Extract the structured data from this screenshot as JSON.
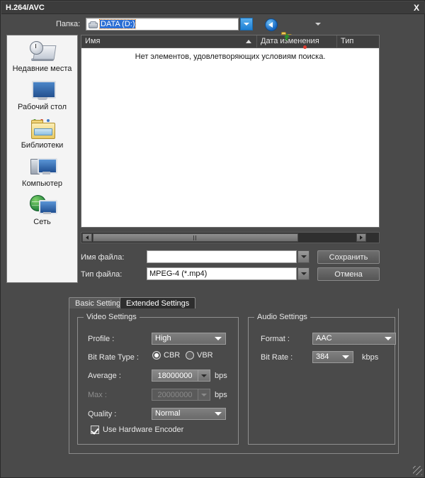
{
  "window": {
    "title": "H.264/AVC",
    "close_label": "X"
  },
  "path_bar": {
    "label": "Папка:",
    "value": "DATA (D:)",
    "dropdown_icon": "chevron-down-icon",
    "buttons": [
      {
        "name": "back-button",
        "icon": "back-arrow-icon"
      },
      {
        "name": "up-folder-button",
        "icon": "folder-up-icon"
      },
      {
        "name": "new-folder-button",
        "icon": "new-folder-icon"
      },
      {
        "name": "views-button",
        "icon": "views-grid-icon"
      }
    ]
  },
  "places": {
    "items": [
      {
        "label": "Недавние места",
        "icon": "recent-places-icon"
      },
      {
        "label": "Рабочий стол",
        "icon": "desktop-icon"
      },
      {
        "label": "Библиотеки",
        "icon": "libraries-folder-icon"
      },
      {
        "label": "Компьютер",
        "icon": "computer-icon"
      },
      {
        "label": "Сеть",
        "icon": "network-icon"
      }
    ]
  },
  "file_list": {
    "columns": [
      {
        "label": "Имя",
        "sorted": "asc"
      },
      {
        "label": "Дата изменения",
        "sorted": ""
      },
      {
        "label": "Тип",
        "sorted": ""
      }
    ],
    "empty_message": "Нет элементов, удовлетворяющих условиям поиска.",
    "rows": []
  },
  "file_fields": {
    "name_label": "Имя файла:",
    "name_value": "",
    "name_placeholder": "",
    "type_label": "Тип файла:",
    "type_value": "MPEG-4 (*.mp4)",
    "save_button": "Сохранить",
    "cancel_button": "Отмена"
  },
  "tabs": [
    {
      "label": "Basic Settings",
      "active": false
    },
    {
      "label": "Extended Settings",
      "active": true
    }
  ],
  "video_settings": {
    "title": "Video Settings",
    "profile_label": "Profile :",
    "profile_value": "High",
    "bitrate_type_label": "Bit Rate Type :",
    "cbr_label": "CBR",
    "vbr_label": "VBR",
    "bitrate_type_selected": "CBR",
    "average_label": "Average :",
    "average_value": "18000000",
    "average_unit": "bps",
    "max_label": "Max :",
    "max_value": "20000000",
    "max_unit": "bps",
    "max_disabled": true,
    "quality_label": "Quality :",
    "quality_value": "Normal",
    "hw_encoder_label": "Use Hardware Encoder",
    "hw_encoder_checked": true
  },
  "audio_settings": {
    "title": "Audio Settings",
    "format_label": "Format :",
    "format_value": "AAC",
    "bitrate_label": "Bit Rate :",
    "bitrate_value": "384",
    "bitrate_unit": "kbps"
  },
  "colors": {
    "window_bg": "#4a4a4a",
    "titlebar_bg": "#3c3c3c",
    "panel_bg": "#2e2e2e",
    "list_bg": "#ffffff",
    "accent_blue": "#2a6ed4"
  }
}
